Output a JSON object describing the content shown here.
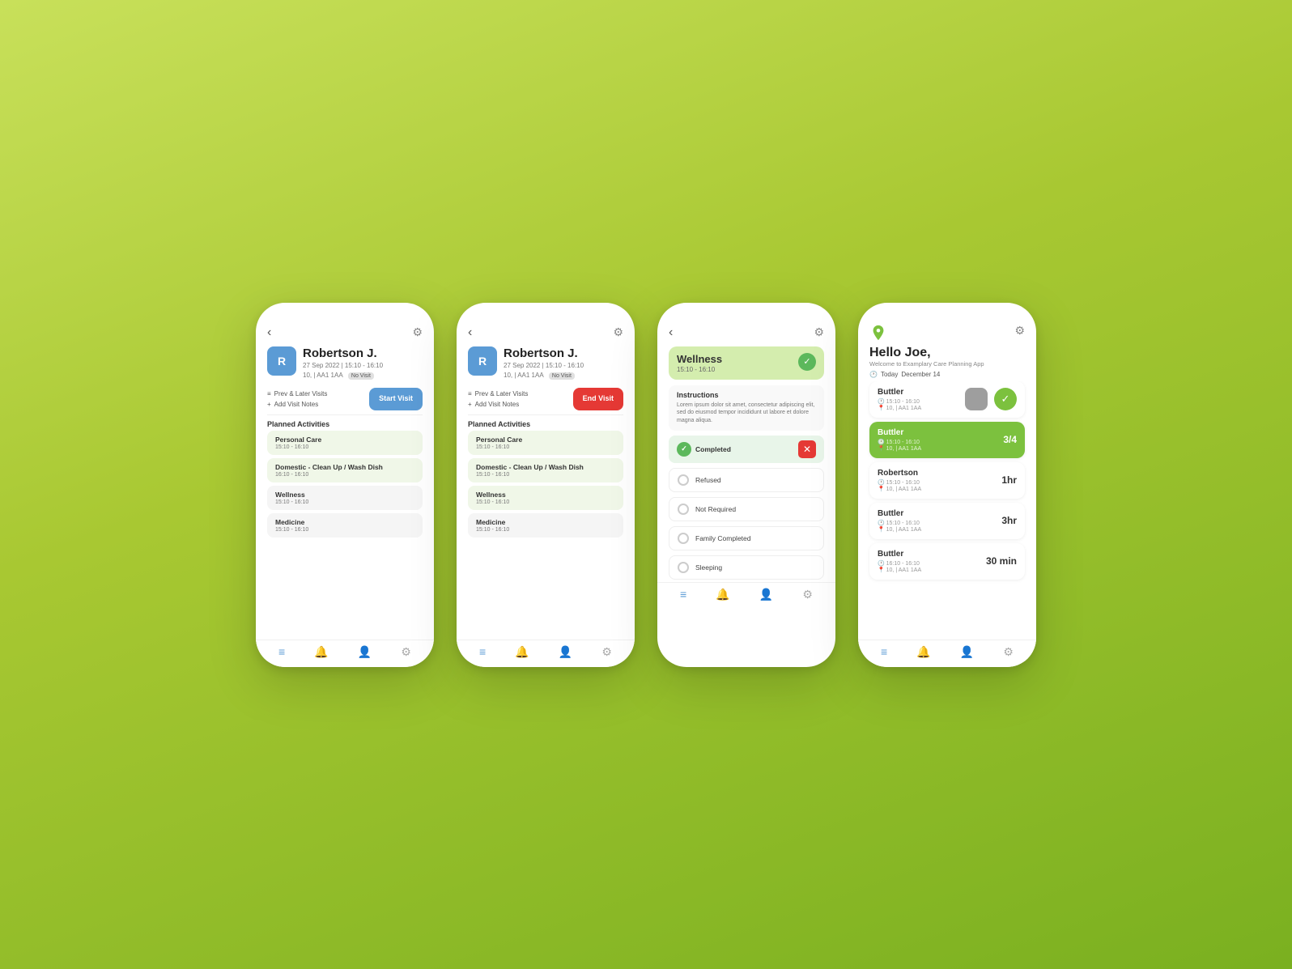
{
  "background": {
    "color": "#b5d94e"
  },
  "phone1": {
    "back": "‹",
    "gear": "⚙",
    "avatar": "R",
    "patient_name": "Robertson J.",
    "date": "27 Sep 2022 | 15:10 - 16:10",
    "location": "10, | AA1 1AA",
    "badge": "No Visit",
    "btn_prev": "Prev & Later Visits",
    "btn_add_note": "Add Visit Notes",
    "btn_start": "Start\nVisit",
    "section_title": "Planned Activities",
    "activities": [
      {
        "name": "Personal Care",
        "time": "15:10 - 16:10",
        "type": "green"
      },
      {
        "name": "Domestic - Clean Up / Wash Dish",
        "time": "16:10 - 16:10",
        "type": "green"
      },
      {
        "name": "Wellness",
        "time": "15:10 - 16:10",
        "type": "grey"
      },
      {
        "name": "Medicine",
        "time": "15:10 - 16:10",
        "type": "grey"
      }
    ]
  },
  "phone2": {
    "back": "‹",
    "gear": "⚙",
    "avatar": "R",
    "patient_name": "Robertson J.",
    "date": "27 Sep 2022 | 15:10 - 16:10",
    "location": "10, | AA1 1AA",
    "badge": "No Visit",
    "btn_prev": "Prev & Later Visits",
    "btn_add_note": "Add Visit Notes",
    "btn_end": "End\nVisit",
    "section_title": "Planned Activities",
    "activities": [
      {
        "name": "Personal Care",
        "time": "15:10 - 16:10",
        "type": "green"
      },
      {
        "name": "Domestic - Clean Up / Wash Dish",
        "time": "15:10 - 16:10",
        "type": "green"
      },
      {
        "name": "Wellness",
        "time": "15:10 - 16:10",
        "type": "green"
      },
      {
        "name": "Medicine",
        "time": "15:10 - 16:10",
        "type": "grey"
      }
    ]
  },
  "phone3": {
    "back": "‹",
    "gear": "⚙",
    "wellness_title": "Wellness",
    "wellness_time": "15:10 - 16:10",
    "instructions_title": "Instructions",
    "instructions_text": "Lorem ipsum dolor sit amet, consectetur adipiscing elit, sed do eiusmod tempor incididunt ut labore et dolore magna aliqua.",
    "completed_label": "Completed",
    "options": [
      "Refused",
      "Not Required",
      "Family Completed",
      "Sleeping"
    ]
  },
  "phone4": {
    "gear": "⚙",
    "greeting": "Hello Joe,",
    "subtitle": "Welcome to Examplary Care Planning App",
    "date_label": "Today",
    "date_value": "December 14",
    "visits": [
      {
        "name": "Buttler",
        "time": "15:10 - 16:10",
        "location": "10, | AA1 1AA",
        "duration": "",
        "type": "check"
      },
      {
        "name": "Buttler",
        "time": "15:10 - 16:10",
        "location": "10, | AA1 1AA",
        "duration": "3/4",
        "type": "active"
      },
      {
        "name": "Robertson",
        "time": "15:10 - 16:10",
        "location": "10, | AA1 1AA",
        "duration": "1hr",
        "type": "normal"
      },
      {
        "name": "Buttler",
        "time": "15:10 - 16:10",
        "location": "10, | AA1 1AA",
        "duration": "3hr",
        "type": "normal"
      },
      {
        "name": "Buttler",
        "time": "16:10 - 16:10",
        "location": "10, | AA1 1AA",
        "duration": "30 min",
        "type": "normal"
      }
    ]
  },
  "nav": {
    "icons": [
      "≡",
      "●",
      "●",
      "⚙"
    ]
  }
}
